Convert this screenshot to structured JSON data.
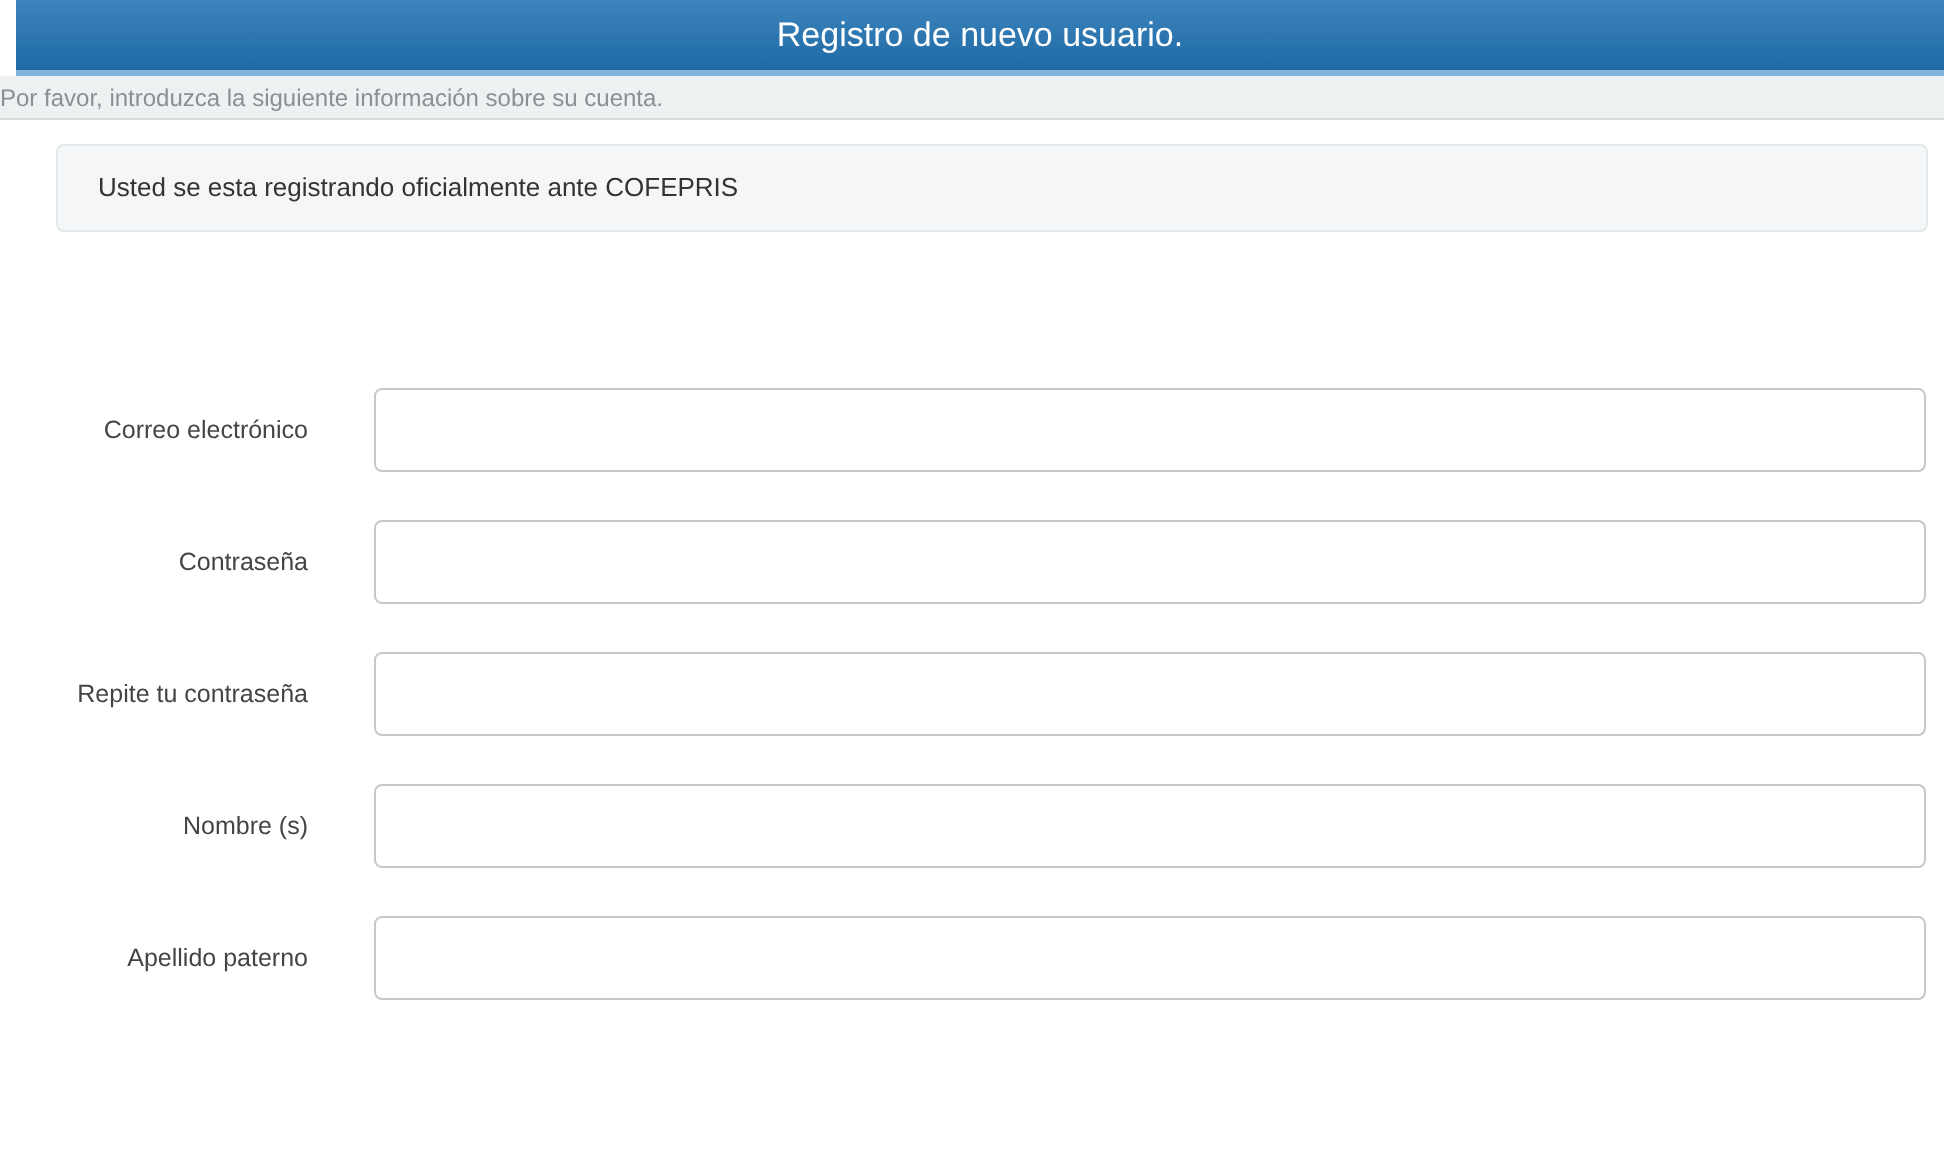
{
  "header": {
    "title": "Registro de nuevo usuario."
  },
  "subtitle": "Por favor, introduzca la siguiente información sobre su cuenta.",
  "notice": "Usted se esta registrando oficialmente ante COFEPRIS",
  "fields": [
    {
      "label": "Correo electrónico"
    },
    {
      "label": "Contraseña"
    },
    {
      "label": "Repite tu contraseña"
    },
    {
      "label": "Nombre (s)"
    },
    {
      "label": "Apellido paterno"
    }
  ]
}
